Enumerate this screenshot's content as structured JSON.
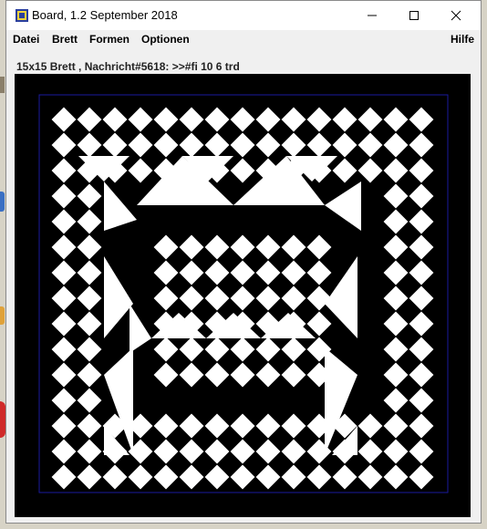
{
  "window": {
    "title": "Board, 1.2 September 2018",
    "controls": [
      "minimize",
      "maximize",
      "close"
    ]
  },
  "menubar": {
    "items": [
      {
        "label": "Datei"
      },
      {
        "label": "Brett"
      },
      {
        "label": "Formen"
      },
      {
        "label": "Optionen"
      }
    ],
    "help_label": "Hilfe"
  },
  "status": {
    "text": "15x15 Brett , Nachricht#5618: >>#fi 10 6 trd"
  },
  "board": {
    "rows": 15,
    "cols": 15,
    "background": "#000000",
    "cell_color": "#ffffff",
    "border_color": "#1a1a9e"
  },
  "colors": {
    "titlebar": "#ffffff",
    "window": "#f0f0f0",
    "desktop": "#d7d3c6"
  }
}
